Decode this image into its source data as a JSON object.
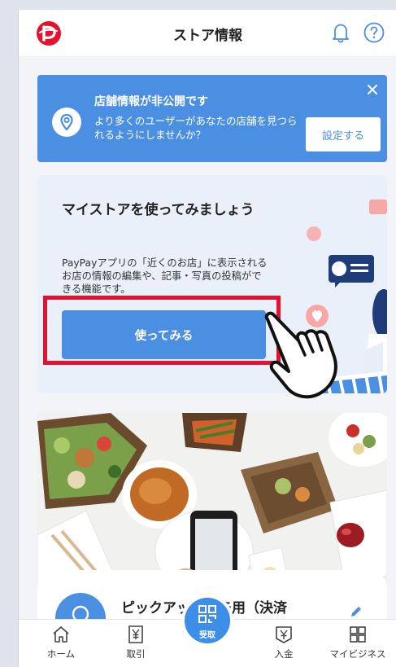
{
  "header": {
    "title": "ストア情報",
    "logo_icon": "paypay-logo",
    "bell_icon": "bell-icon",
    "help_icon": "help-icon"
  },
  "banner": {
    "title": "店舗情報が非公開です",
    "description": "より多くのユーザーがあなたの店舗を見つられるようにしませんか？",
    "button_label": "設定する",
    "close_icon": "close-icon",
    "pin_icon": "location-pin-icon"
  },
  "mystore": {
    "title": "マイストアを使ってみましょう",
    "description": "PayPayアプリの「近くのお店」に表示されるお店の情報の編集や、記事・写真の投稿ができる機能です。",
    "button_label": "使ってみる"
  },
  "store": {
    "name": "ピックアップデモ用（決済"
  },
  "nav": {
    "items": [
      {
        "label": "ホーム",
        "icon": "home-icon"
      },
      {
        "label": "取引",
        "icon": "receipt-icon"
      },
      {
        "label": "受取",
        "icon": "qr-scan-icon"
      },
      {
        "label": "入金",
        "icon": "deposit-icon"
      },
      {
        "label": "マイビジネス",
        "icon": "grid-icon"
      }
    ]
  },
  "colors": {
    "accent": "#4a8fe1",
    "brand_red": "#e8112d",
    "highlight_red": "#e8112d"
  }
}
